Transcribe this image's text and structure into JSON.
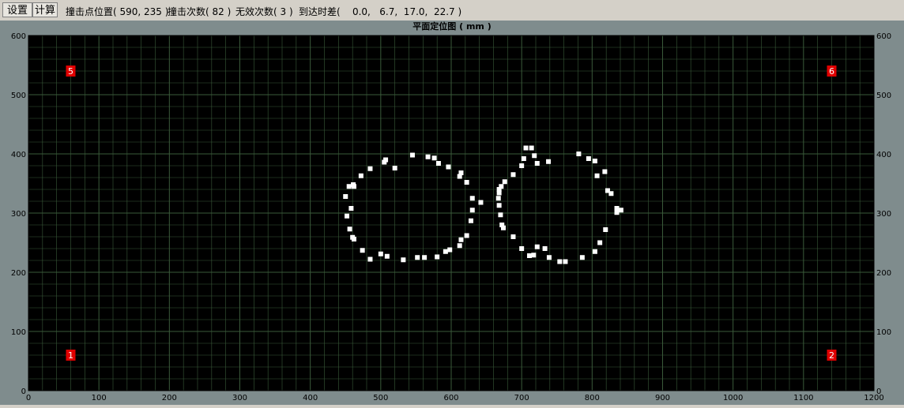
{
  "toolbar": {
    "settings_label": "设置",
    "calc_label": "计算",
    "impact_pos": "撞击点位置( 590, 235 )",
    "impact_count": "撞击次数( 82 )",
    "invalid_count": "无效次数( 3 )",
    "arrival_diff": "到达时差(    0.0,   6.7,  17.0,  22.7 )"
  },
  "chart_data": {
    "type": "scatter",
    "title": "平面定位图 ( mm )",
    "xlabel": "",
    "ylabel": "",
    "xlim": [
      0,
      1200
    ],
    "ylim": [
      0,
      600
    ],
    "x_ticks": [
      "0",
      "100",
      "200",
      "300",
      "400",
      "500",
      "600",
      "700",
      "800",
      "900",
      "1000",
      "1100",
      "1200"
    ],
    "y_ticks": [
      "0",
      "100",
      "200",
      "300",
      "400",
      "500",
      "600"
    ],
    "grid": true,
    "background": "#000000",
    "grid_color": "#3a5a3a",
    "point_color": "#ffffff",
    "sensor_color": "#e00000",
    "sensors": [
      {
        "label": "1",
        "x": 60,
        "y": 60
      },
      {
        "label": "2",
        "x": 1140,
        "y": 60
      },
      {
        "label": "5",
        "x": 60,
        "y": 540
      },
      {
        "label": "6",
        "x": 1140,
        "y": 540
      }
    ],
    "points": [
      [
        545,
        398
      ],
      [
        567,
        395
      ],
      [
        576,
        393
      ],
      [
        582,
        384
      ],
      [
        596,
        378
      ],
      [
        612,
        362
      ],
      [
        614,
        368
      ],
      [
        622,
        352
      ],
      [
        630,
        325
      ],
      [
        630,
        305
      ],
      [
        628,
        287
      ],
      [
        622,
        262
      ],
      [
        614,
        255
      ],
      [
        612,
        245
      ],
      [
        598,
        238
      ],
      [
        592,
        235
      ],
      [
        580,
        226
      ],
      [
        562,
        225
      ],
      [
        552,
        225
      ],
      [
        532,
        221
      ],
      [
        509,
        227
      ],
      [
        500,
        231
      ],
      [
        485,
        222
      ],
      [
        474,
        237
      ],
      [
        462,
        256
      ],
      [
        460,
        259
      ],
      [
        456,
        273
      ],
      [
        452,
        295
      ],
      [
        458,
        308
      ],
      [
        450,
        328
      ],
      [
        455,
        345
      ],
      [
        461,
        348
      ],
      [
        462,
        345
      ],
      [
        472,
        363
      ],
      [
        485,
        375
      ],
      [
        505,
        386
      ],
      [
        507,
        390
      ],
      [
        520,
        376
      ],
      [
        642,
        318
      ],
      [
        714,
        410
      ],
      [
        706,
        410
      ],
      [
        781,
        400
      ],
      [
        795,
        392
      ],
      [
        804,
        388
      ],
      [
        818,
        370
      ],
      [
        807,
        363
      ],
      [
        822,
        338
      ],
      [
        827,
        333
      ],
      [
        835,
        308
      ],
      [
        841,
        305
      ],
      [
        835,
        301
      ],
      [
        819,
        272
      ],
      [
        811,
        250
      ],
      [
        804,
        235
      ],
      [
        786,
        225
      ],
      [
        762,
        218
      ],
      [
        754,
        218
      ],
      [
        739,
        225
      ],
      [
        733,
        240
      ],
      [
        722,
        243
      ],
      [
        717,
        229
      ],
      [
        711,
        228
      ],
      [
        700,
        240
      ],
      [
        688,
        260
      ],
      [
        674,
        275
      ],
      [
        672,
        280
      ],
      [
        670,
        297
      ],
      [
        668,
        313
      ],
      [
        667,
        325
      ],
      [
        668,
        334
      ],
      [
        668,
        340
      ],
      [
        671,
        345
      ],
      [
        676,
        353
      ],
      [
        688,
        365
      ],
      [
        700,
        380
      ],
      [
        703,
        392
      ],
      [
        718,
        397
      ],
      [
        722,
        384
      ],
      [
        738,
        387
      ]
    ]
  }
}
